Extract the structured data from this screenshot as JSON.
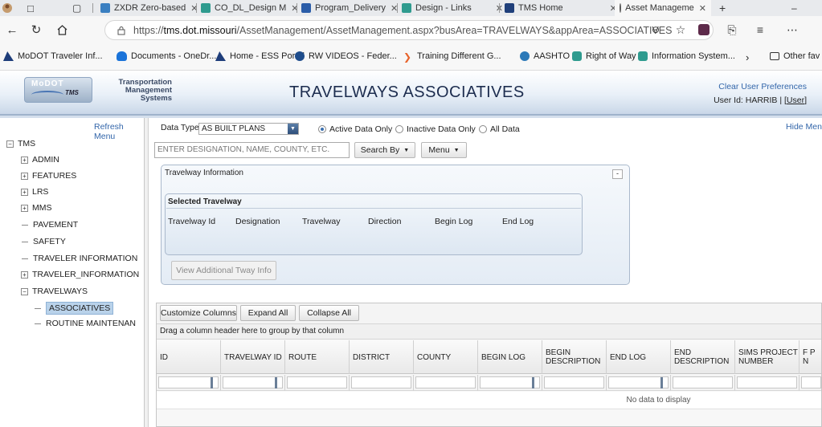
{
  "browser": {
    "tabs": [
      {
        "label": "ZXDR Zero-based",
        "color": "#3a7fc1"
      },
      {
        "label": "CO_DL_Design M",
        "color": "#2f9b8f"
      },
      {
        "label": "Program_Delivery",
        "color": "#2b5da8"
      },
      {
        "label": "Design - Links",
        "color": "#2f9b8f"
      },
      {
        "label": "TMS Home",
        "color": "#1f3f7a"
      },
      {
        "label": "Asset Manageme",
        "color": "#5b5b5b"
      }
    ],
    "url": {
      "prefix": "https://",
      "host": "tms.dot.missouri",
      "path": "/AssetManagement/AssetManagement.aspx?busArea=TRAVELWAYS&appArea=ASSOCIATIVES"
    },
    "bookmarks": [
      {
        "label": "MoDOT Traveler Inf...",
        "icon": "modot-icon"
      },
      {
        "label": "Documents - OneDr...",
        "icon": "cloud-icon"
      },
      {
        "label": "Home - ESS Portal",
        "icon": "modot-icon"
      },
      {
        "label": "RW VIDEOS - Feder...",
        "icon": "video-icon"
      },
      {
        "label": "Training Different G...",
        "icon": "training-icon"
      },
      {
        "label": "AASHTO",
        "icon": "aashto-icon"
      },
      {
        "label": "Right of Way",
        "icon": "teams-icon"
      },
      {
        "label": "Information System...",
        "icon": "teams-icon"
      },
      {
        "label": "Other fav",
        "icon": "folder-icon"
      }
    ]
  },
  "header": {
    "logo_lines": [
      "Transportation",
      "Management",
      "Systems"
    ],
    "logo_badge": "MoDOT",
    "logo_tms": "TMS",
    "title": "TRAVELWAYS ASSOCIATIVES",
    "clear_prefs": "Clear User Preferences",
    "user_prefix": "User Id: HARRIB | [",
    "user_link": "User",
    "user_suffix": "]"
  },
  "sidebar": {
    "refresh": "Refresh Menu",
    "root": "TMS",
    "items": [
      {
        "label": "ADMIN",
        "type": "plus"
      },
      {
        "label": "FEATURES",
        "type": "plus"
      },
      {
        "label": "LRS",
        "type": "plus"
      },
      {
        "label": "MMS",
        "type": "plus"
      },
      {
        "label": "PAVEMENT",
        "type": "leaf"
      },
      {
        "label": "SAFETY",
        "type": "leaf"
      },
      {
        "label": "TRAVELER INFORMATION",
        "type": "leaf"
      },
      {
        "label": "TRAVELER_INFORMATION",
        "type": "plus"
      },
      {
        "label": "TRAVELWAYS",
        "type": "minus"
      }
    ],
    "children": [
      {
        "label": "ASSOCIATIVES",
        "selected": true
      },
      {
        "label": "ROUTINE MAINTENAN",
        "selected": false
      }
    ]
  },
  "main": {
    "data_type_label": "Data Type",
    "data_type_value": "AS BUILT PLANS",
    "radios": [
      {
        "label": "Active Data Only",
        "checked": true
      },
      {
        "label": "Inactive Data Only",
        "checked": false
      },
      {
        "label": "All Data",
        "checked": false
      }
    ],
    "hide_menu": "Hide Men",
    "search_placeholder": "ENTER DESIGNATION, NAME, COUNTY, ETC.",
    "search_by": "Search By",
    "menu": "Menu",
    "panel_title": "Travelway Information",
    "collapse_symbol": "-",
    "selected_title": "Selected Travelway",
    "selected_cols": [
      "Travelway Id",
      "Designation",
      "Travelway",
      "Direction",
      "Begin Log",
      "End Log"
    ],
    "view_btn": "View Additional Tway Info",
    "grid": {
      "toolbar": [
        "Customize Columns",
        "Expand All",
        "Collapse All"
      ],
      "group_hint": "Drag a column header here to group by that column",
      "columns": [
        "ID",
        "TRAVELWAY ID",
        "ROUTE",
        "DISTRICT",
        "COUNTY",
        "BEGIN LOG",
        "BEGIN DESCRIPTION",
        "END LOG",
        "END DESCRIPTION",
        "SIMS PROJECT NUMBER",
        "F P N"
      ],
      "no_data": "No data to display"
    }
  }
}
